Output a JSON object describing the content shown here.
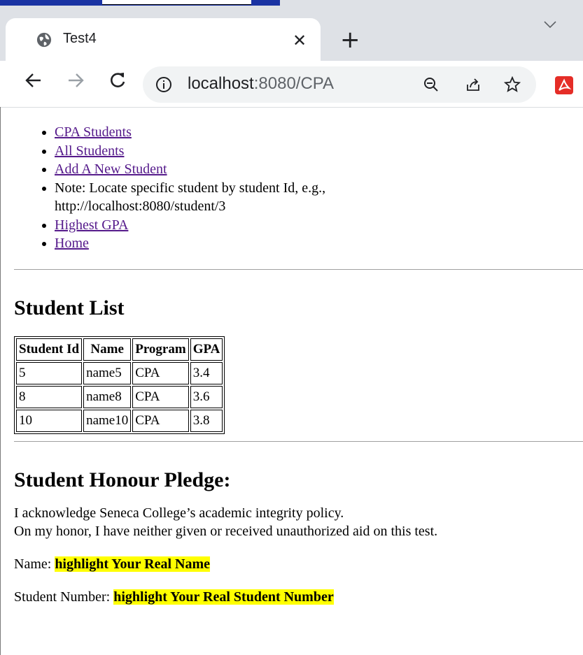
{
  "browser": {
    "tab_title": "Test4",
    "url_host": "localhost",
    "url_path": ":8080/CPA"
  },
  "nav": {
    "items": [
      {
        "label": "CPA Students"
      },
      {
        "label": "All Students"
      },
      {
        "label": "Add A New Student"
      }
    ],
    "note_line1": "Note: Locate specific student by student Id, e.g.,",
    "note_line2": "http://localhost:8080/student/3",
    "items2": [
      {
        "label": "Highest GPA"
      },
      {
        "label": "Home"
      }
    ]
  },
  "student_list": {
    "heading": "Student List",
    "columns": [
      "Student Id",
      "Name",
      "Program",
      "GPA"
    ],
    "rows": [
      [
        "5",
        "name5",
        "CPA",
        "3.4"
      ],
      [
        "8",
        "name8",
        "CPA",
        "3.6"
      ],
      [
        "10",
        "name10",
        "CPA",
        "3.8"
      ]
    ]
  },
  "pledge": {
    "heading": "Student Honour Pledge:",
    "line1": "I acknowledge Seneca College’s academic integrity policy.",
    "line2": "On my honor, I have neither given or received unauthorized aid on this test.",
    "name_label": "Name: ",
    "name_value": "highlight Your Real Name",
    "number_label": "Student Number: ",
    "number_value": "highlight Your Real Student Number"
  },
  "colors": {
    "link": "#551a8b",
    "highlight": "#ffff00",
    "tabbar": "#dee1e6",
    "omnibox": "#f1f3f4"
  }
}
